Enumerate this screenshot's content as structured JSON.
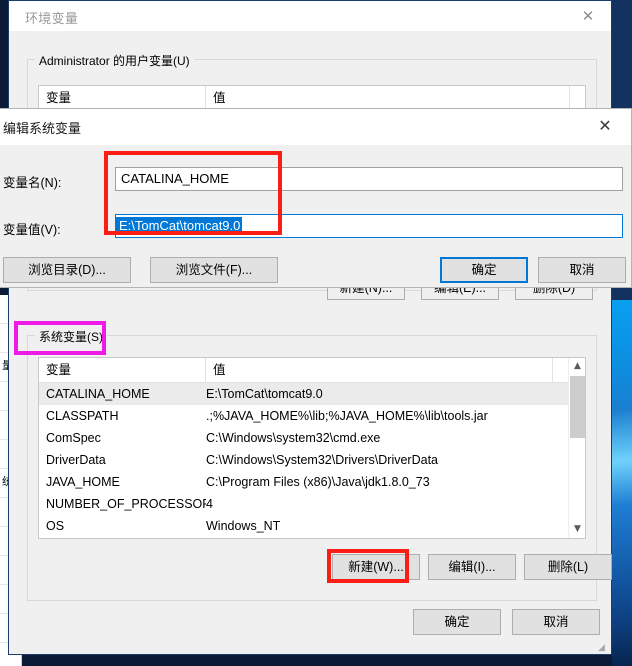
{
  "env_window": {
    "title": "环境变量",
    "close_icon": "close-icon",
    "user_group_legend": "Administrator 的用户变量(U)",
    "user_table": {
      "columns": [
        "变量",
        "值"
      ]
    },
    "user_buttons": [
      "新建(N)...",
      "编辑(E)...",
      "删除(D)"
    ],
    "system_group_legend": "系统变量(S)",
    "system_table": {
      "columns": [
        "变量",
        "值"
      ],
      "rows": [
        {
          "name": "CATALINA_HOME",
          "value": "E:\\TomCat\\tomcat9.0",
          "selected": true
        },
        {
          "name": "CLASSPATH",
          "value": ".;%JAVA_HOME%\\lib;%JAVA_HOME%\\lib\\tools.jar",
          "selected": false
        },
        {
          "name": "ComSpec",
          "value": "C:\\Windows\\system32\\cmd.exe",
          "selected": false
        },
        {
          "name": "DriverData",
          "value": "C:\\Windows\\System32\\Drivers\\DriverData",
          "selected": false
        },
        {
          "name": "JAVA_HOME",
          "value": "C:\\Program Files (x86)\\Java\\jdk1.8.0_73",
          "selected": false
        },
        {
          "name": "NUMBER_OF_PROCESSORS",
          "value": "4",
          "selected": false
        },
        {
          "name": "OS",
          "value": "Windows_NT",
          "selected": false
        }
      ]
    },
    "system_buttons": {
      "new": "新建(W)...",
      "edit": "编辑(I)...",
      "delete": "删除(L)"
    },
    "footer_buttons": {
      "ok": "确定",
      "cancel": "取消"
    },
    "scrollbar": {
      "up_icon": "chevron-up-icon",
      "down_icon": "chevron-down-icon"
    }
  },
  "edit_dialog": {
    "title": "编辑系统变量",
    "close_icon": "close-icon",
    "name_label": "变量名(N):",
    "name_value": "CATALINA_HOME",
    "value_label": "变量值(V):",
    "value_value": "E:\\TomCat\\tomcat9.0",
    "browse_dir_button": "浏览目录(D)...",
    "browse_file_button": "浏览文件(F)...",
    "ok_button": "确定",
    "cancel_button": "取消"
  },
  "annotations": {
    "fields_highlight_color": "#fa1e14",
    "system_legend_highlight_color": "#ef1ae8",
    "new_button_highlight_color": "#fa1e14"
  },
  "background_window": {
    "rows": [
      "",
      "量",
      "",
      "",
      "",
      "",
      "统",
      "",
      "",
      "",
      "",
      ""
    ]
  },
  "colors": {
    "accent": "#0078d7",
    "dialog_bg": "#f0f0f0",
    "selection_bg": "#0078d7",
    "row_selected_bg": "#ebebeb"
  }
}
